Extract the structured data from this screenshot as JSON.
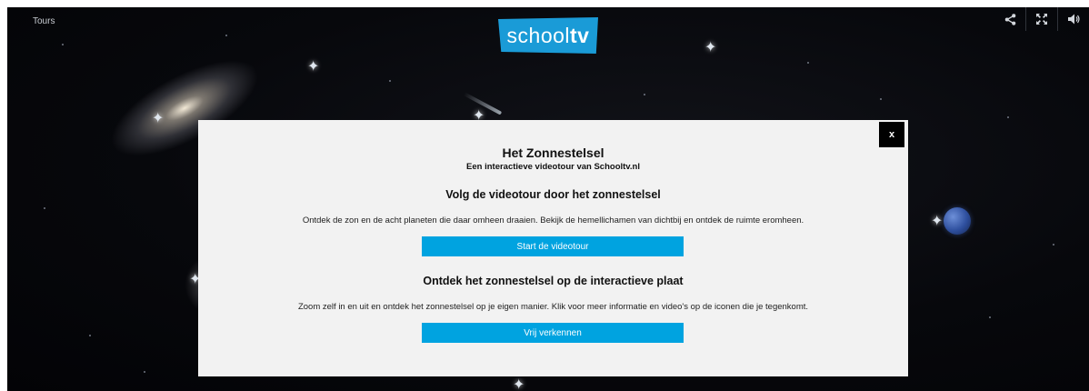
{
  "header": {
    "tours_label": "Tours",
    "logo_text_light": "school",
    "logo_text_bold": "tv"
  },
  "controls": {
    "share_icon": "share-icon",
    "fullscreen_icon": "fullscreen-icon",
    "volume_icon": "volume-icon"
  },
  "modal": {
    "close_label": "x",
    "title": "Het Zonnestelsel",
    "subtitle": "Een interactieve videotour van Schooltv.nl",
    "section1": {
      "heading": "Volg de videotour door het zonnestelsel",
      "text": "Ontdek de zon en de acht planeten die daar omheen draaien. Bekijk de hemellichamen van dichtbij en ontdek de ruimte eromheen.",
      "button_label": "Start de videotour"
    },
    "section2": {
      "heading": "Ontdek het zonnestelsel op de interactieve plaat",
      "text": "Zoom zelf in en uit en ontdek het zonnestelsel op je eigen manier. Klik voor meer informatie en video's op de iconen die je tegenkomt.",
      "button_label": "Vrij verkennen"
    }
  },
  "colors": {
    "brand_blue": "#1a9bd7",
    "button_blue": "#00a3e0",
    "modal_bg": "#f2f2f2",
    "space_bg": "#07080c"
  }
}
